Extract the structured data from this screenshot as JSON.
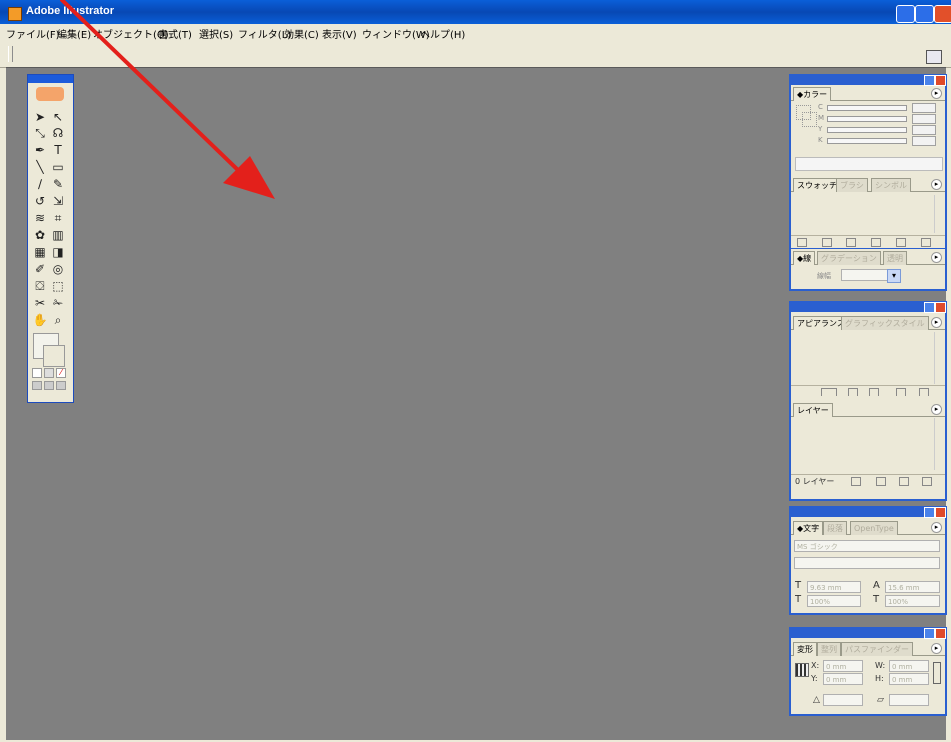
{
  "app": {
    "title": "Adobe Illustrator"
  },
  "menu": [
    "ファイル(F)",
    "編集(E)",
    "オブジェクト(O)",
    "書式(T)",
    "選択(S)",
    "フィルタ(L)",
    "効果(C)",
    "表示(V)",
    "ウィンドウ(W)",
    "ヘルプ(H)"
  ],
  "panels": {
    "color": {
      "tab": "◆カラー",
      "sliders": [
        "C",
        "M",
        "Y",
        "K"
      ]
    },
    "swatches": {
      "tabs": [
        "スウォッチ",
        "ブラシ",
        "シンボル"
      ]
    },
    "stroke": {
      "tabs": [
        "◆線",
        "グラデーション",
        "透明"
      ],
      "weight_label": "線幅"
    },
    "appearance": {
      "tabs": [
        "アピアランス",
        "グラフィックスタイル"
      ]
    },
    "layers": {
      "tab": "レイヤー",
      "count": "0 レイヤー"
    },
    "character": {
      "tabs": [
        "◆文字",
        "段落",
        "OpenType"
      ],
      "font": "MS ゴシック",
      "size": "9.63 mm",
      "leading": "15.6 mm",
      "scale_h": "100%",
      "scale_v": "100%"
    },
    "transform": {
      "tabs": [
        "変形",
        "整列",
        "パスファインダー"
      ],
      "x_label": "X:",
      "y_label": "Y:",
      "w_label": "W:",
      "h_label": "H:",
      "x": "0 mm",
      "y": "0 mm",
      "w": "0 mm",
      "h": "0 mm"
    }
  },
  "colors": {
    "workspace": "#808080",
    "titlebar": "#0a5fd8",
    "annotation_arrow": "#e3201b"
  }
}
